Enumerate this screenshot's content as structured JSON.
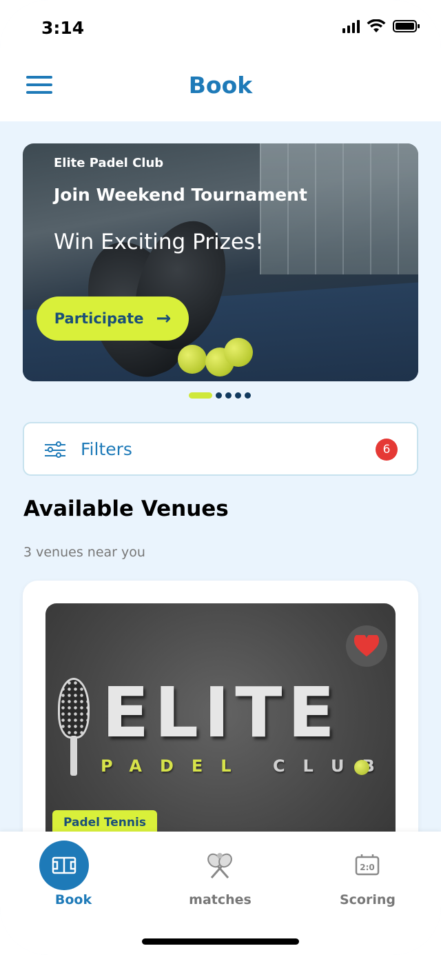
{
  "status_bar": {
    "time": "3:14"
  },
  "header": {
    "title": "Book"
  },
  "banner": {
    "club": "Elite Padel Club",
    "headline": "Join Weekend Tournament",
    "subheadline": "Win Exciting Prizes!",
    "cta_label": "Participate",
    "carousel": {
      "active_index": 0,
      "total": 5
    }
  },
  "filters": {
    "label": "Filters",
    "count": "6"
  },
  "venues": {
    "title": "Available Venues",
    "subtitle": "3 venues near you",
    "items": [
      {
        "logo_text": "ELITE",
        "logo_sub_1": "PADEL",
        "logo_sub_2": "CLUB",
        "tag": "Padel Tennis",
        "favorite": true
      }
    ]
  },
  "bottom_nav": {
    "items": [
      {
        "label": "Book",
        "icon": "court-icon",
        "active": true
      },
      {
        "label": "matches",
        "icon": "crossed-rackets-icon",
        "active": false
      },
      {
        "label": "Scoring",
        "icon": "scoreboard-icon",
        "active": false
      }
    ]
  },
  "colors": {
    "primary": "#1e7ab8",
    "accent": "#d9f03a",
    "background": "#eaf4fd",
    "badge": "#e53935"
  }
}
